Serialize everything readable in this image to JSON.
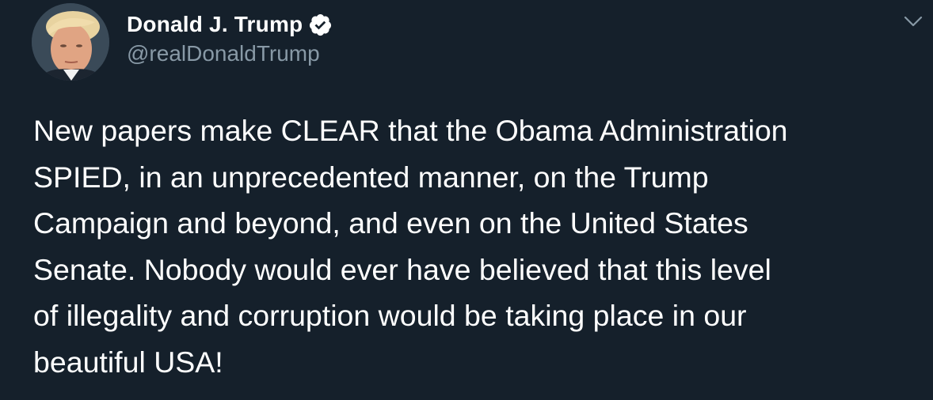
{
  "author": {
    "display_name": "Donald J. Trump",
    "handle": "@realDonaldTrump",
    "verified": true
  },
  "tweet": {
    "text": "New papers make CLEAR that the Obama Administration\nSPIED, in an unprecedented manner, on the Trump\nCampaign and beyond, and even on the United States\nSenate. Nobody would ever have believed that this level\nof illegality and corruption would be taking place in our\nbeautiful USA!"
  },
  "icons": {
    "verified": "verified-badge-icon",
    "menu": "chevron-down-icon"
  },
  "colors": {
    "background": "#15202b",
    "text": "#ffffff",
    "secondary_text": "#8899a6"
  }
}
